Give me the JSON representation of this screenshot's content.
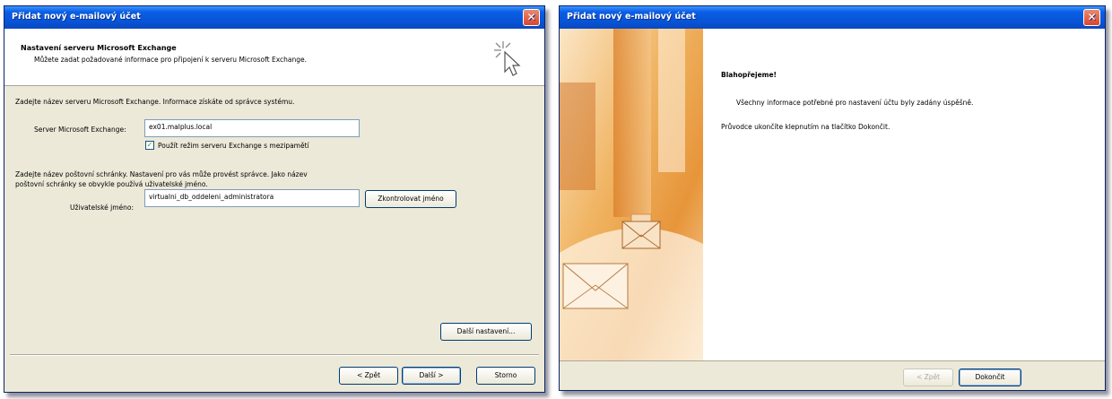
{
  "left_dialog": {
    "title": "Přidat nový e-mailový účet",
    "header_title": "Nastavení serveru Microsoft Exchange",
    "header_subtitle": "Můžete zadat požadované informace pro připojení k serveru Microsoft Exchange.",
    "server_intro": "Zadejte název serveru Microsoft Exchange. Informace získáte od správce systému.",
    "server_label": "Server Microsoft Exchange:",
    "server_value": "ex01.malplus.local",
    "cached_mode_label": "Použít režim serveru Exchange s mezipamětí",
    "cached_mode_checked": true,
    "mailbox_intro_line1": "Zadejte název poštovní schránky. Nastavení pro vás může provést správce. Jako název",
    "mailbox_intro_line2": "poštovní schránky se obvykle používá uživatelské jméno.",
    "username_label": "Uživatelské jméno:",
    "username_value": "virtualni_db_oddeleni_administratora",
    "check_name_button": "Zkontrolovat jméno",
    "more_settings_button": "Další nastavení...",
    "back_button": "< Zpět",
    "next_button": "Další >",
    "cancel_button": "Storno"
  },
  "right_dialog": {
    "title": "Přidat nový e-mailový účet",
    "heading": "Blahopřejeme!",
    "line1": "Všechny informace potřebné pro nastavení účtu byly zadány úspěšně.",
    "line2": "Průvodce ukončíte klepnutím na tlačítko Dokončit.",
    "back_button": "< Zpět",
    "finish_button": "Dokončit"
  },
  "colors": {
    "titlebar": "#0a5fe4",
    "dialog_bg": "#ece9d8",
    "close": "#d9462b",
    "art_orange": "#e89a3c"
  }
}
